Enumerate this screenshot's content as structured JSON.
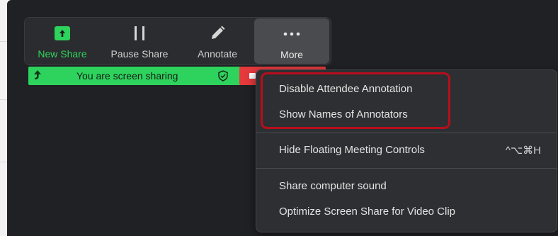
{
  "toolbar": {
    "new_share": "New Share",
    "pause_share": "Pause Share",
    "annotate": "Annotate",
    "more": "More"
  },
  "share_bar": {
    "status": "You are screen sharing"
  },
  "menu": {
    "items": [
      "Disable Attendee Annotation",
      "Show Names of Annotators",
      "Hide Floating Meeting Controls",
      "Share computer sound",
      "Optimize Screen Share for Video Clip"
    ],
    "shortcut_hide_controls": "^⌥⌘H"
  },
  "colors": {
    "accent_green": "#2dd35c",
    "stop_red": "#e5393c",
    "highlight_red": "#b80e1c",
    "background": "#202124"
  }
}
